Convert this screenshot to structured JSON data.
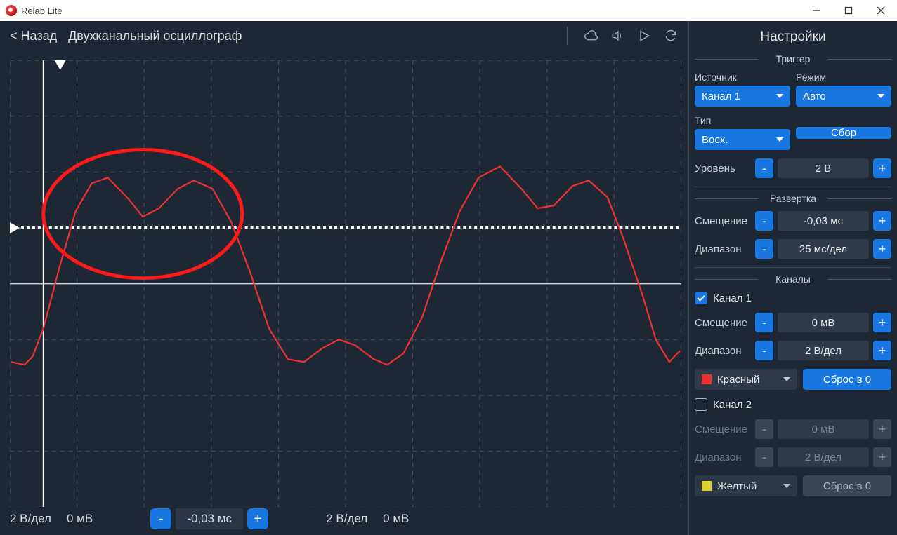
{
  "window": {
    "title": "Relab Lite"
  },
  "header": {
    "back": "< Назад",
    "title": "Двухканальный осциллограф"
  },
  "footer": {
    "scale1": "2 В/дел",
    "offset1": "0 мВ",
    "time_offset": "-0,03 мс",
    "scale2": "2 В/дел",
    "offset2": "0 мВ"
  },
  "sidebar": {
    "title": "Настройки",
    "trigger": {
      "title": "Триггер",
      "source_label": "Источник",
      "source_value": "Канал 1",
      "mode_label": "Режим",
      "mode_value": "Авто",
      "type_label": "Тип",
      "type_value": "Восх.",
      "run_label": "Сбор",
      "level_label": "Уровень",
      "level_value": "2 В"
    },
    "sweep": {
      "title": "Развертка",
      "offset_label": "Смещение",
      "offset_value": "-0,03 мс",
      "range_label": "Диапазон",
      "range_value": "25 мс/дел"
    },
    "channels": {
      "title": "Каналы",
      "ch1_label": "Канал 1",
      "offset_label": "Смещение",
      "ch1_offset": "0 мВ",
      "range_label": "Диапазон",
      "ch1_range": "2 В/дел",
      "color1_label": "Красный",
      "reset_label": "Сброс в 0",
      "ch2_label": "Канал 2",
      "ch2_offset": "0 мВ",
      "ch2_range": "2 В/дел",
      "color2_label": "Желтый"
    }
  },
  "chart_data": {
    "type": "line",
    "xlabel": "",
    "ylabel": "",
    "xlim": [
      -12.5,
      237.5
    ],
    "ylim": [
      -8,
      8
    ],
    "x_grid_step": 25,
    "y_grid_step": 2,
    "trigger_level": 2,
    "trigger_time": 0,
    "zero_line": 0,
    "annotation": {
      "type": "ellipse",
      "cx": 37,
      "cy": 2.5,
      "rx": 37,
      "ry": 2.3,
      "color": "#ff1a1a"
    },
    "series": [
      {
        "name": "Канал 1",
        "color": "#ed3131",
        "points": [
          [
            -12,
            -2.8
          ],
          [
            -7,
            -2.9
          ],
          [
            -4,
            -2.6
          ],
          [
            0,
            -1.6
          ],
          [
            6,
            0.6
          ],
          [
            12,
            2.6
          ],
          [
            18,
            3.6
          ],
          [
            24,
            3.8
          ],
          [
            32,
            3.0
          ],
          [
            37,
            2.4
          ],
          [
            43,
            2.7
          ],
          [
            50,
            3.4
          ],
          [
            56,
            3.7
          ],
          [
            63,
            3.4
          ],
          [
            70,
            2.2
          ],
          [
            77,
            0.4
          ],
          [
            84,
            -1.6
          ],
          [
            91,
            -2.7
          ],
          [
            97,
            -2.8
          ],
          [
            104,
            -2.3
          ],
          [
            110,
            -2.0
          ],
          [
            116,
            -2.2
          ],
          [
            123,
            -2.7
          ],
          [
            128,
            -2.9
          ],
          [
            134,
            -2.5
          ],
          [
            141,
            -1.2
          ],
          [
            148,
            0.8
          ],
          [
            155,
            2.6
          ],
          [
            162,
            3.8
          ],
          [
            170,
            4.2
          ],
          [
            178,
            3.4
          ],
          [
            184,
            2.7
          ],
          [
            190,
            2.8
          ],
          [
            197,
            3.5
          ],
          [
            203,
            3.7
          ],
          [
            210,
            3.1
          ],
          [
            216,
            1.6
          ],
          [
            223,
            -0.4
          ],
          [
            228,
            -2.0
          ],
          [
            233,
            -2.8
          ],
          [
            237,
            -2.4
          ]
        ]
      }
    ]
  }
}
